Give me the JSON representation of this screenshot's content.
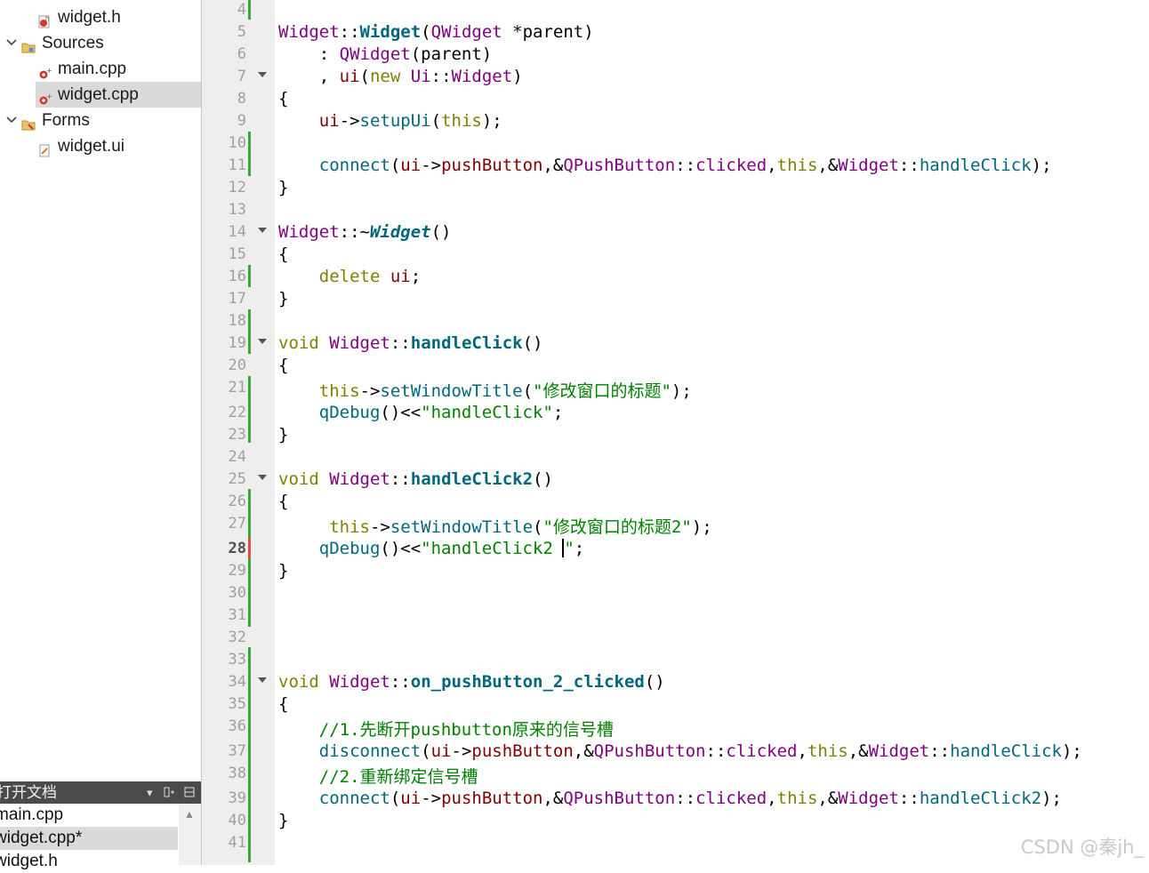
{
  "tree": {
    "items": [
      {
        "label": "widget.h",
        "type": "header",
        "expanded": null
      },
      {
        "label": "Sources",
        "type": "folder",
        "expanded": true
      },
      {
        "label": "main.cpp",
        "type": "source",
        "expanded": null
      },
      {
        "label": "widget.cpp",
        "type": "source",
        "expanded": null,
        "selected": true
      },
      {
        "label": "Forms",
        "type": "folder",
        "expanded": true
      },
      {
        "label": "widget.ui",
        "type": "form",
        "expanded": null
      }
    ]
  },
  "open_docs": {
    "title": "打开文档",
    "items": [
      {
        "label": "main.cpp"
      },
      {
        "label": "widget.cpp*",
        "selected": true
      },
      {
        "label": "widget.h"
      }
    ]
  },
  "editor": {
    "current_line": 28,
    "lines": [
      {
        "n": "4"
      },
      {
        "n": "5"
      },
      {
        "n": "6"
      },
      {
        "n": "7"
      },
      {
        "n": "8"
      },
      {
        "n": "9"
      },
      {
        "n": "10"
      },
      {
        "n": "11"
      },
      {
        "n": "12"
      },
      {
        "n": "13"
      },
      {
        "n": "14"
      },
      {
        "n": "15"
      },
      {
        "n": "16"
      },
      {
        "n": "17"
      },
      {
        "n": "18"
      },
      {
        "n": "19"
      },
      {
        "n": "20"
      },
      {
        "n": "21"
      },
      {
        "n": "22"
      },
      {
        "n": "23"
      },
      {
        "n": "24"
      },
      {
        "n": "25"
      },
      {
        "n": "26"
      },
      {
        "n": "27"
      },
      {
        "n": "28"
      },
      {
        "n": "29"
      },
      {
        "n": "30"
      },
      {
        "n": "31"
      },
      {
        "n": "32"
      },
      {
        "n": "33"
      },
      {
        "n": "34"
      },
      {
        "n": "35"
      },
      {
        "n": "36"
      },
      {
        "n": "37"
      },
      {
        "n": "38"
      },
      {
        "n": "39"
      },
      {
        "n": "40"
      },
      {
        "n": "41"
      }
    ],
    "code": {
      "l5": [
        "Widget",
        "::",
        "Widget",
        "(",
        "QWidget",
        " *parent)"
      ],
      "l6": [
        "    : ",
        "QWidget",
        "(parent)"
      ],
      "l7": [
        "    , ",
        "ui",
        "(",
        "new",
        " ",
        "Ui",
        "::",
        "Widget",
        ")"
      ],
      "l8": [
        "{"
      ],
      "l9": [
        "    ",
        "ui",
        "->",
        "setupUi",
        "(",
        "this",
        ");"
      ],
      "l11": [
        "    ",
        "connect",
        "(",
        "ui",
        "->",
        "pushButton",
        ",&",
        "QPushButton",
        "::",
        "clicked",
        ",",
        "this",
        ",&",
        "Widget",
        "::",
        "handleClick",
        ");"
      ],
      "l12": [
        "}"
      ],
      "l14": [
        "Widget",
        "::~",
        "Widget",
        "()"
      ],
      "l15": [
        "{"
      ],
      "l16": [
        "    ",
        "delete",
        " ",
        "ui",
        ";"
      ],
      "l17": [
        "}"
      ],
      "l19": [
        "void",
        " ",
        "Widget",
        "::",
        "handleClick",
        "()"
      ],
      "l20": [
        "{"
      ],
      "l21": [
        "    ",
        "this",
        "->",
        "setWindowTitle",
        "(",
        "\"修改窗口的标题\"",
        ");"
      ],
      "l22": [
        "    ",
        "qDebug",
        "()<<",
        "\"handleClick\"",
        ";"
      ],
      "l23": [
        "}"
      ],
      "l25": [
        "void",
        " ",
        "Widget",
        "::",
        "handleClick2",
        "()"
      ],
      "l26": [
        "{"
      ],
      "l27": [
        "     ",
        "this",
        "->",
        "setWindowTitle",
        "(",
        "\"修改窗口的标题2\"",
        ");"
      ],
      "l28": [
        "    ",
        "qDebug",
        "()<<",
        "\"handleClick2 ",
        "\"",
        ";"
      ],
      "l29": [
        "}"
      ],
      "l34": [
        "void",
        " ",
        "Widget",
        "::",
        "on_pushButton_2_clicked",
        "()"
      ],
      "l35": [
        "{"
      ],
      "l36": [
        "    ",
        "//1.先断开pushbutton原来的信号槽"
      ],
      "l37": [
        "    ",
        "disconnect",
        "(",
        "ui",
        "->",
        "pushButton",
        ",&",
        "QPushButton",
        "::",
        "clicked",
        ",",
        "this",
        ",&",
        "Widget",
        "::",
        "handleClick",
        ");"
      ],
      "l38": [
        "    ",
        "//2.重新绑定信号槽"
      ],
      "l39": [
        "    ",
        "connect",
        "(",
        "ui",
        "->",
        "pushButton",
        ",&",
        "QPushButton",
        "::",
        "clicked",
        ",",
        "this",
        ",&",
        "Widget",
        "::",
        "handleClick2",
        ");"
      ],
      "l40": [
        "}"
      ]
    }
  },
  "watermark": "CSDN @秦jh_",
  "colors": {
    "keyword": "#808000",
    "type": "#800080",
    "function": "#00677c",
    "member": "#800000",
    "string": "#008000",
    "change_mark": "#39a935",
    "current_change_mark": "#e24b4b"
  }
}
